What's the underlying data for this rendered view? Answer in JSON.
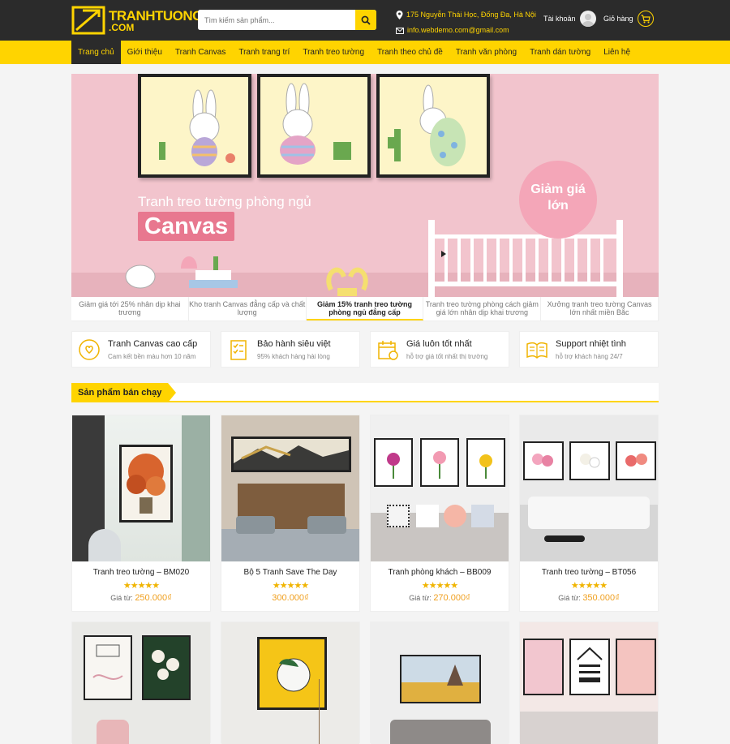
{
  "header": {
    "brand_line1": "TRANHTUONGAZ",
    "brand_line2": ".COM",
    "search_placeholder": "Tìm kiếm sản phẩm...",
    "address": "175 Nguyễn Thái Học, Đống Đa, Hà Nội",
    "email": "info.webdemo.com@gmail.com",
    "account_label": "Tài khoản",
    "cart_label": "Giỏ hàng"
  },
  "nav": {
    "items": [
      {
        "label": "Trang chủ",
        "active": true
      },
      {
        "label": "Giới thiệu"
      },
      {
        "label": "Tranh Canvas"
      },
      {
        "label": "Tranh trang trí"
      },
      {
        "label": "Tranh treo tường"
      },
      {
        "label": "Tranh theo chủ đề"
      },
      {
        "label": "Tranh văn phòng"
      },
      {
        "label": "Tranh dán tường"
      },
      {
        "label": "Liên hệ"
      }
    ]
  },
  "banner": {
    "title": "Tranh treo tường phòng ngủ",
    "highlight": "Canvas",
    "sale_line1": "Giảm giá",
    "sale_line2": "lớn"
  },
  "slider_tabs": [
    "Giảm giá tới 25% nhân dịp khai trương",
    "Kho tranh Canvas đẳng cấp và chất lượng",
    "Giảm 15% tranh treo tường phòng ngủ đẳng cấp",
    "Tranh treo tường phòng cách giảm giá lớn nhân dịp khai trương",
    "Xưởng tranh treo tường Canvas lớn nhất miền Bắc"
  ],
  "features": [
    {
      "title": "Tranh Canvas cao cấp",
      "sub": "Cam kết bền màu hơn 10 năm",
      "icon": "hand-heart-icon"
    },
    {
      "title": "Bảo hành siêu việt",
      "sub": "95% khách hàng hài lòng",
      "icon": "checklist-icon"
    },
    {
      "title": "Giá luôn tốt nhất",
      "sub": "hỗ trợ giá tốt nhất thị trường",
      "icon": "calendar-money-icon"
    },
    {
      "title": "Support nhiệt tình",
      "sub": "hỗ trợ khách hàng 24/7",
      "icon": "book-icon"
    }
  ],
  "section": {
    "title": "Sản phẩm bán chạy"
  },
  "products": [
    {
      "name": "Tranh treo tường – BM020",
      "rating": 5,
      "price_label": "Giá từ:",
      "price": "250.000₫"
    },
    {
      "name": "Bộ 5 Tranh Save The Day",
      "rating": 5,
      "price_label": "",
      "price": "300.000₫"
    },
    {
      "name": "Tranh phòng khách – BB009",
      "rating": 5,
      "price_label": "Giá từ:",
      "price": "270.000₫"
    },
    {
      "name": "Tranh treo tường – BT056",
      "rating": 5,
      "price_label": "Giá từ:",
      "price": "350.000₫"
    }
  ],
  "stars_text": "★★★★★",
  "colors": {
    "accent": "#ffd400",
    "dark": "#2b2b2b",
    "price": "#f0a020",
    "banner": "#f2c4cd"
  }
}
